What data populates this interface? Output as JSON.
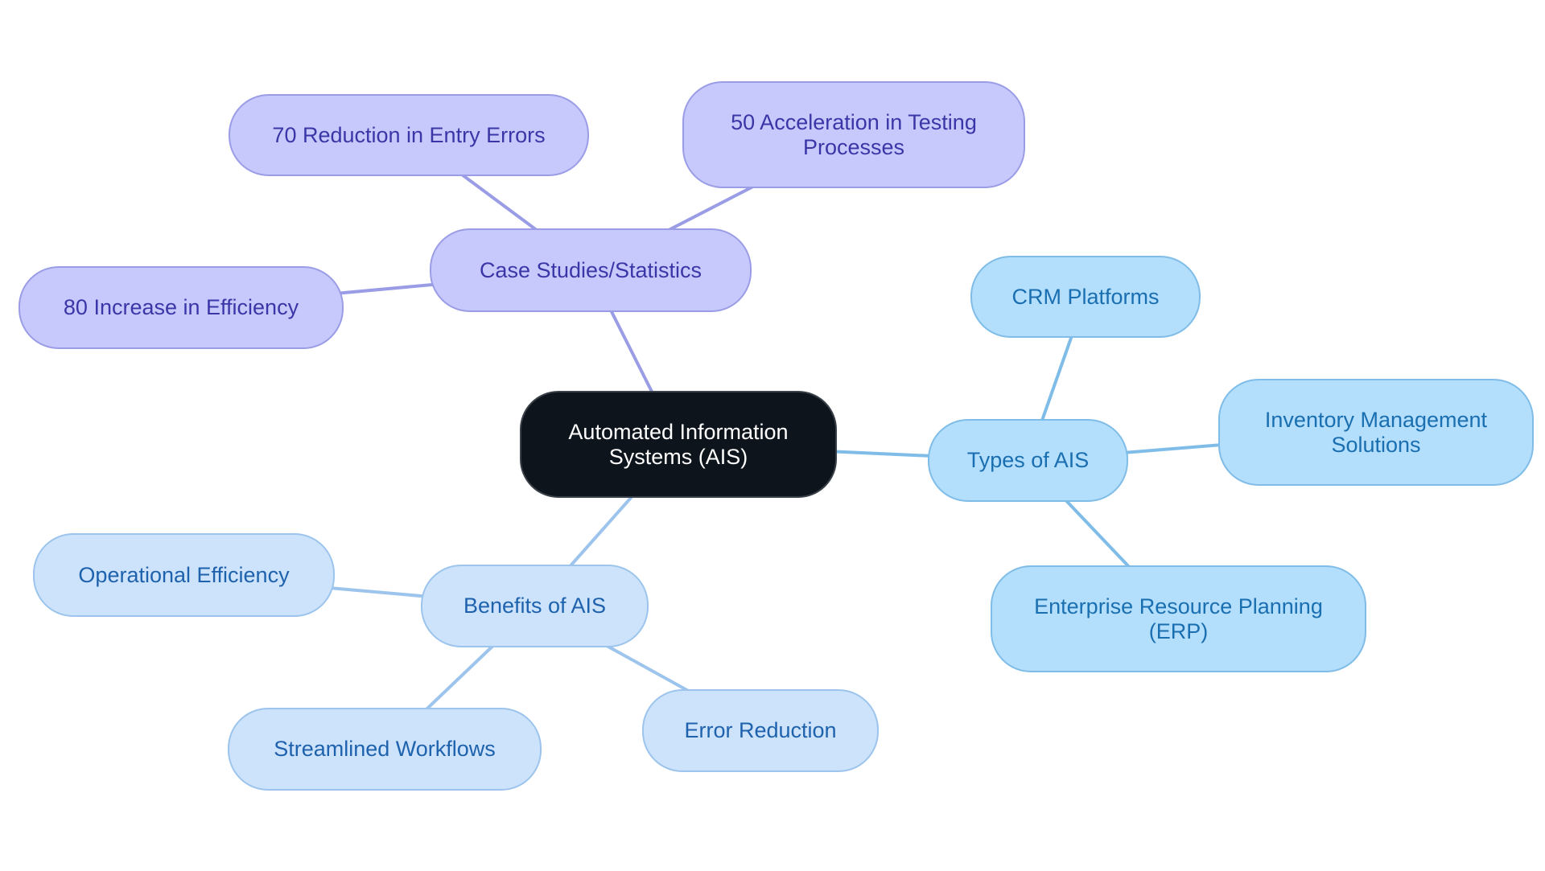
{
  "diagram": {
    "type": "mind-map",
    "root": {
      "id": "root",
      "label": "Automated Information Systems (AIS)"
    },
    "branches": [
      {
        "id": "case",
        "label": "Case Studies/Statistics",
        "color": "#9a9de6",
        "children": [
          {
            "id": "c1",
            "label": "70 Reduction in Entry Errors"
          },
          {
            "id": "c2",
            "label": "50 Acceleration in Testing Processes"
          },
          {
            "id": "c3",
            "label": "80 Increase in Efficiency"
          }
        ]
      },
      {
        "id": "types",
        "label": "Types of AIS",
        "color": "#7fbde8",
        "children": [
          {
            "id": "t1",
            "label": "CRM Platforms"
          },
          {
            "id": "t2",
            "label": "Inventory Management Solutions"
          },
          {
            "id": "t3",
            "label": "Enterprise Resource Planning (ERP)"
          }
        ]
      },
      {
        "id": "benefits",
        "label": "Benefits of AIS",
        "color": "#9cc4ec",
        "children": [
          {
            "id": "b1",
            "label": "Operational Efficiency"
          },
          {
            "id": "b2",
            "label": "Streamlined Workflows"
          },
          {
            "id": "b3",
            "label": "Error Reduction"
          }
        ]
      }
    ]
  },
  "colors": {
    "root_fill": "#0d141b",
    "case_fill": "#c7c9fc",
    "types_fill": "#b3defc",
    "benefits_fill": "#cde3fb"
  }
}
